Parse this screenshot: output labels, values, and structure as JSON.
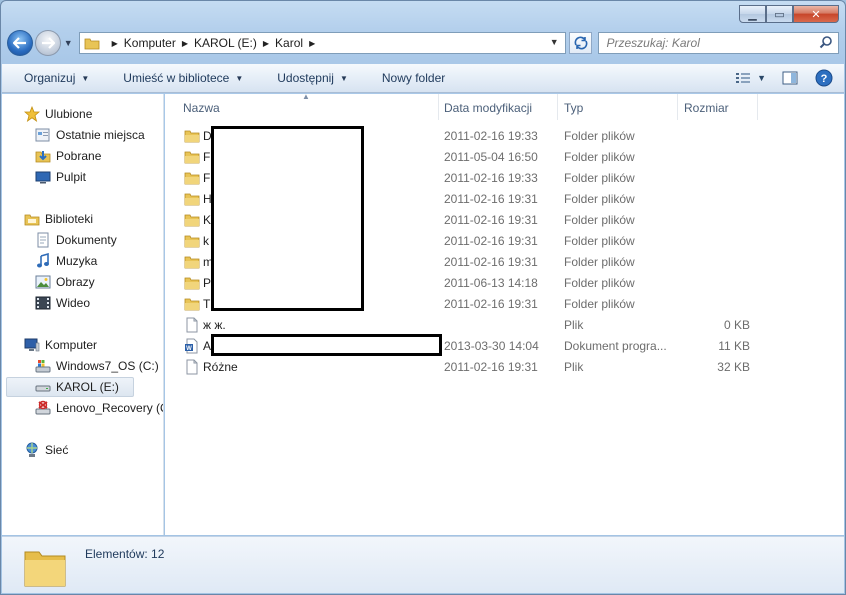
{
  "window": {
    "caption": {
      "minimize": "▁",
      "maximize": "▭",
      "close": "✕"
    }
  },
  "address": {
    "crumbs": [
      "Komputer",
      "KAROL (E:)",
      "Karol"
    ]
  },
  "search": {
    "placeholder": "Przeszukaj: Karol"
  },
  "toolbar": {
    "organize": "Organizuj",
    "include_library": "Umieść w bibliotece",
    "share": "Udostępnij",
    "new_folder": "Nowy folder"
  },
  "nav": {
    "favorites": "Ulubione",
    "recent": "Ostatnie miejsca",
    "downloads": "Pobrane",
    "desktop": "Pulpit",
    "libraries": "Biblioteki",
    "documents": "Dokumenty",
    "music": "Muzyka",
    "pictures": "Obrazy",
    "videos": "Wideo",
    "computer": "Komputer",
    "drive_c": "Windows7_OS (C:)",
    "drive_e": "KAROL (E:)",
    "drive_q": "Lenovo_Recovery (Q",
    "network": "Sieć"
  },
  "columns": {
    "name": "Nazwa",
    "date": "Data modyfikacji",
    "type": "Typ",
    "size": "Rozmiar"
  },
  "files": [
    {
      "name": "D",
      "date": "2011-02-16 19:33",
      "type": "Folder plików",
      "size": "",
      "icon": "folder-icon"
    },
    {
      "name": "F",
      "date": "2011-05-04 16:50",
      "type": "Folder plików",
      "size": "",
      "icon": "folder-icon"
    },
    {
      "name": "F",
      "date": "2011-02-16 19:33",
      "type": "Folder plików",
      "size": "",
      "icon": "folder-icon"
    },
    {
      "name": "H",
      "date": "2011-02-16 19:31",
      "type": "Folder plików",
      "size": "",
      "icon": "folder-icon"
    },
    {
      "name": "K",
      "date": "2011-02-16 19:31",
      "type": "Folder plików",
      "size": "",
      "icon": "folder-icon"
    },
    {
      "name": "k",
      "date": "2011-02-16 19:31",
      "type": "Folder plików",
      "size": "",
      "icon": "folder-icon"
    },
    {
      "name": "m",
      "date": "2011-02-16 19:31",
      "type": "Folder plików",
      "size": "",
      "icon": "folder-icon"
    },
    {
      "name": "P",
      "date": "2011-06-13 14:18",
      "type": "Folder plików",
      "size": "",
      "icon": "folder-icon"
    },
    {
      "name": "T",
      "date": "2011-02-16 19:31",
      "type": "Folder plików",
      "size": "",
      "icon": "folder-icon"
    },
    {
      "name": "ж ж.",
      "date": "",
      "type": "Plik",
      "size": "0 KB",
      "icon": "file-icon"
    },
    {
      "name": "A",
      "date": "2013-03-30 14:04",
      "type": "Dokument progra...",
      "size": "11 KB",
      "icon": "word-doc-icon"
    },
    {
      "name": "Różne",
      "date": "2011-02-16 19:31",
      "type": "Plik",
      "size": "32 KB",
      "icon": "file-icon"
    }
  ],
  "details": {
    "count": "Elementów: 12"
  }
}
